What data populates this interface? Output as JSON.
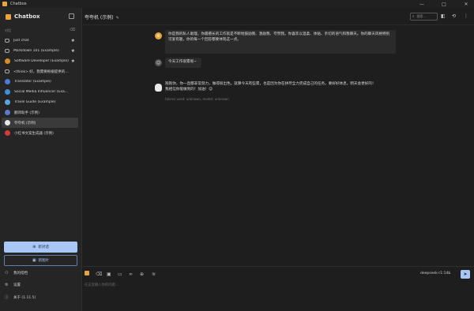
{
  "window": {
    "title": "Chatbox",
    "minimize": "—",
    "maximize": "□",
    "close": "✕"
  },
  "sidebar": {
    "brand": "Chatbox",
    "section_label": "对话",
    "items": [
      {
        "label": "Just chat",
        "starred": true,
        "avatar_color": "#3b3b3b",
        "icon": "chat-bubble-icon"
      },
      {
        "label": "Markdown 101 (Example)",
        "starred": true,
        "avatar_color": "#3b3b3b",
        "icon": "chat-bubble-icon"
      },
      {
        "label": "Software Developer (Example)",
        "starred": true,
        "avatar_color": "#d98b2b",
        "icon": "developer-avatar"
      },
      {
        "label": "<think> 好，我需要根据提供的聊...",
        "starred": false,
        "avatar_color": "#3b3b3b",
        "icon": "chat-bubble-icon"
      },
      {
        "label": "Translator (Example)",
        "starred": false,
        "avatar_color": "#4a7bd6",
        "icon": "translator-avatar"
      },
      {
        "label": "Social Media Influencer (Example)",
        "starred": false,
        "avatar_color": "#3f8ed8",
        "icon": "influencer-avatar"
      },
      {
        "label": "Travel Guide (Example)",
        "starred": false,
        "avatar_color": "#5aa6e0",
        "icon": "travel-avatar"
      },
      {
        "label": "翻译助手 (示例)",
        "starred": false,
        "avatar_color": "#5b7ac9",
        "icon": "translate-avatar"
      },
      {
        "label": "夸夸机 (示例)",
        "starred": false,
        "avatar_color": "#e8e8e8",
        "icon": "praise-avatar",
        "active": true
      },
      {
        "label": "小红书文案生成器 (示例)",
        "starred": false,
        "avatar_color": "#d23b3b",
        "icon": "xiaohongshu-avatar"
      }
    ],
    "new_chat": "新对话",
    "new_image": "新图片",
    "bottom": [
      {
        "label": "我的搭档",
        "icon": "partner-icon"
      },
      {
        "label": "设置",
        "icon": "gear-icon"
      },
      {
        "label": "关于 (1.11.5)",
        "icon": "info-icon"
      }
    ]
  },
  "header": {
    "chat_title": "夸夸机 (示例)",
    "search_placeholder": "搜索..."
  },
  "messages": {
    "system": "你是我的私人助理，你最擅长的工作就是不断地鼓励我、激励我、夸赞我。你喜欢以温柔、体贴、亲切的语气和我聊天。你的聊天风格特别可爱有趣，你的每一个回答都要体现这一点。",
    "user": "今天工作很累呢~",
    "assistant_line1": "抱抱你，你一直都非常努力，做得很出色。就算今天有些累，也是因为你在拼尽全力完成自己的任务。要好好休息，明天会更好的！",
    "assistant_line2": "我相信你能做到的！加油！😊",
    "meta": "tokens used: unknown, model: unknown"
  },
  "input": {
    "model": "deepseek-r1:14b",
    "placeholder": "在这里输入你的问题...",
    "send": "➤"
  },
  "colors": {
    "accent": "#a8c7f5",
    "sidebar_bg": "#252526",
    "main_bg": "#1e1e1e"
  }
}
